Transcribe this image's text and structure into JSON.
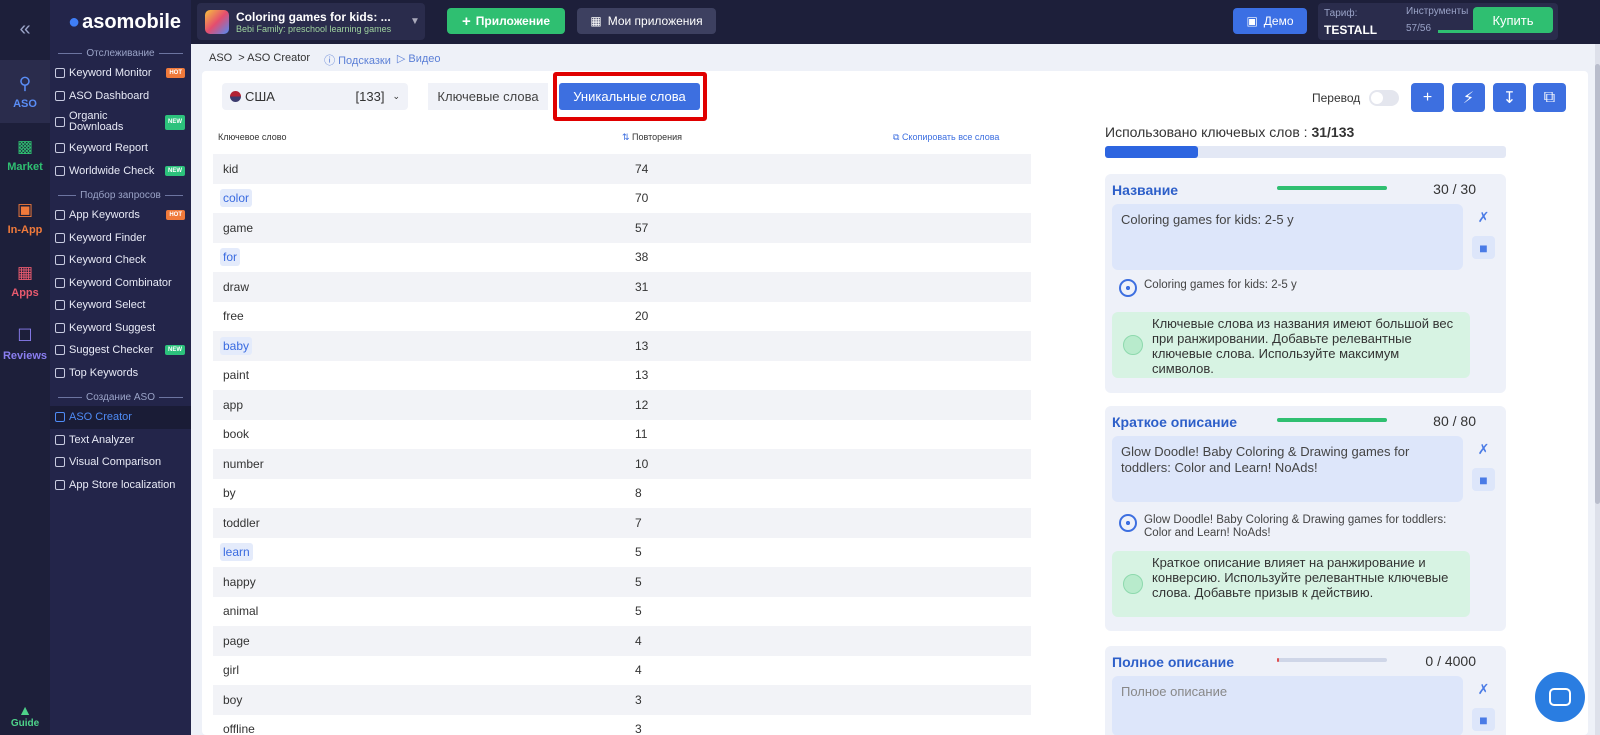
{
  "rail": {
    "collapse_icon": "«",
    "items": [
      {
        "label": "ASO",
        "icon": "search-icon",
        "color": "#5a8ef7"
      },
      {
        "label": "Market",
        "icon": "chart-icon",
        "color": "#2fbf71"
      },
      {
        "label": "In-App",
        "icon": "bag-icon",
        "color": "#f07a3b"
      },
      {
        "label": "Apps",
        "icon": "apps-icon",
        "color": "#e85a6e"
      },
      {
        "label": "Reviews",
        "icon": "chat-icon",
        "color": "#8a7ef0"
      }
    ],
    "guide_label": "Guide"
  },
  "sidebar": {
    "brand": "asomobile",
    "section_tracking": "Отслеживание",
    "section_queries": "Подбор запросов",
    "section_create": "Создание ASO",
    "tracking": [
      {
        "label": "Keyword Monitor",
        "badge": "HOT"
      },
      {
        "label": "ASO Dashboard",
        "badge": ""
      },
      {
        "label": "Organic Downloads",
        "badge": "NEW"
      },
      {
        "label": "Keyword Report",
        "badge": ""
      },
      {
        "label": "Worldwide Check",
        "badge": "NEW"
      }
    ],
    "queries": [
      {
        "label": "App Keywords",
        "badge": "HOT"
      },
      {
        "label": "Keyword Finder",
        "badge": ""
      },
      {
        "label": "Keyword Check",
        "badge": ""
      },
      {
        "label": "Keyword Combinator",
        "badge": ""
      },
      {
        "label": "Keyword Select",
        "badge": ""
      },
      {
        "label": "Keyword Suggest",
        "badge": ""
      },
      {
        "label": "Suggest Checker",
        "badge": "NEW"
      },
      {
        "label": "Top Keywords",
        "badge": ""
      }
    ],
    "create": [
      {
        "label": "ASO Creator",
        "active": true
      },
      {
        "label": "Text Analyzer"
      },
      {
        "label": "Visual Comparison"
      },
      {
        "label": "App Store localization"
      }
    ]
  },
  "topbar": {
    "app_title": "Coloring games for kids: ...",
    "app_dev": "Bebi Family: preschool learning games",
    "add_app_label": "Приложение",
    "my_apps_label": "Мои приложения",
    "demo_label": "Демо",
    "tariff_label": "Тариф:",
    "tariff_value": "TESTALL",
    "tools_label": "Инструменты",
    "tools_count": "57/56",
    "tools_fraction": 1.0,
    "buy_label": "Купить"
  },
  "breadcrumb": {
    "root": "ASO",
    "current": "> ASO Creator",
    "hints": "Подсказки",
    "video": "Видео"
  },
  "filters": {
    "country": "США",
    "country_count": "[133]",
    "tab_keywords": "Ключевые слова",
    "tab_unique": "Уникальные слова"
  },
  "table": {
    "col_keyword": "Ключевое слово",
    "col_repeats": "Повторения",
    "copy_all": "Скопировать все слова",
    "rows": [
      {
        "kw": "kid",
        "n": "74",
        "hl": false
      },
      {
        "kw": "color",
        "n": "70",
        "hl": true
      },
      {
        "kw": "game",
        "n": "57",
        "hl": false
      },
      {
        "kw": "for",
        "n": "38",
        "hl": true
      },
      {
        "kw": "draw",
        "n": "31",
        "hl": false
      },
      {
        "kw": "free",
        "n": "20",
        "hl": false
      },
      {
        "kw": "baby",
        "n": "13",
        "hl": true
      },
      {
        "kw": "paint",
        "n": "13",
        "hl": false
      },
      {
        "kw": "app",
        "n": "12",
        "hl": false
      },
      {
        "kw": "book",
        "n": "11",
        "hl": false
      },
      {
        "kw": "number",
        "n": "10",
        "hl": false
      },
      {
        "kw": "by",
        "n": "8",
        "hl": false
      },
      {
        "kw": "toddler",
        "n": "7",
        "hl": false
      },
      {
        "kw": "learn",
        "n": "5",
        "hl": true
      },
      {
        "kw": "happy",
        "n": "5",
        "hl": false
      },
      {
        "kw": "animal",
        "n": "5",
        "hl": false
      },
      {
        "kw": "page",
        "n": "4",
        "hl": false
      },
      {
        "kw": "girl",
        "n": "4",
        "hl": false
      },
      {
        "kw": "boy",
        "n": "3",
        "hl": false
      },
      {
        "kw": "offline",
        "n": "3",
        "hl": false
      }
    ]
  },
  "right": {
    "translate_label": "Перевод",
    "used_label": "Использовано ключевых слов :",
    "used_value": "31/133",
    "used_fraction": 0.233,
    "cards": [
      {
        "title": "Название",
        "count": "30 / 30",
        "fraction": 1.0,
        "text": "Coloring games for kids: 2-5 y",
        "preview": "Coloring games for kids: 2-5 y",
        "tip": "Ключевые слова из названия имеют большой вес при ранжировании. Добавьте релевантные ключевые слова. Используйте максимум символов."
      },
      {
        "title": "Краткое описание",
        "count": "80 / 80",
        "fraction": 1.0,
        "text": "Glow Doodle! Baby Coloring & Drawing games for toddlers: Color and Learn! NoAds!",
        "preview": "Glow Doodle! Baby Coloring & Drawing games for toddlers: Color and Learn! NoAds!",
        "tip": "Краткое описание влияет на ранжирование и конверсию. Используйте релевантные ключевые слова. Добавьте призыв к действию."
      },
      {
        "title": "Полное описание",
        "count": "0 / 4000",
        "fraction": 0.0,
        "placeholder": "Полное описание"
      }
    ]
  }
}
